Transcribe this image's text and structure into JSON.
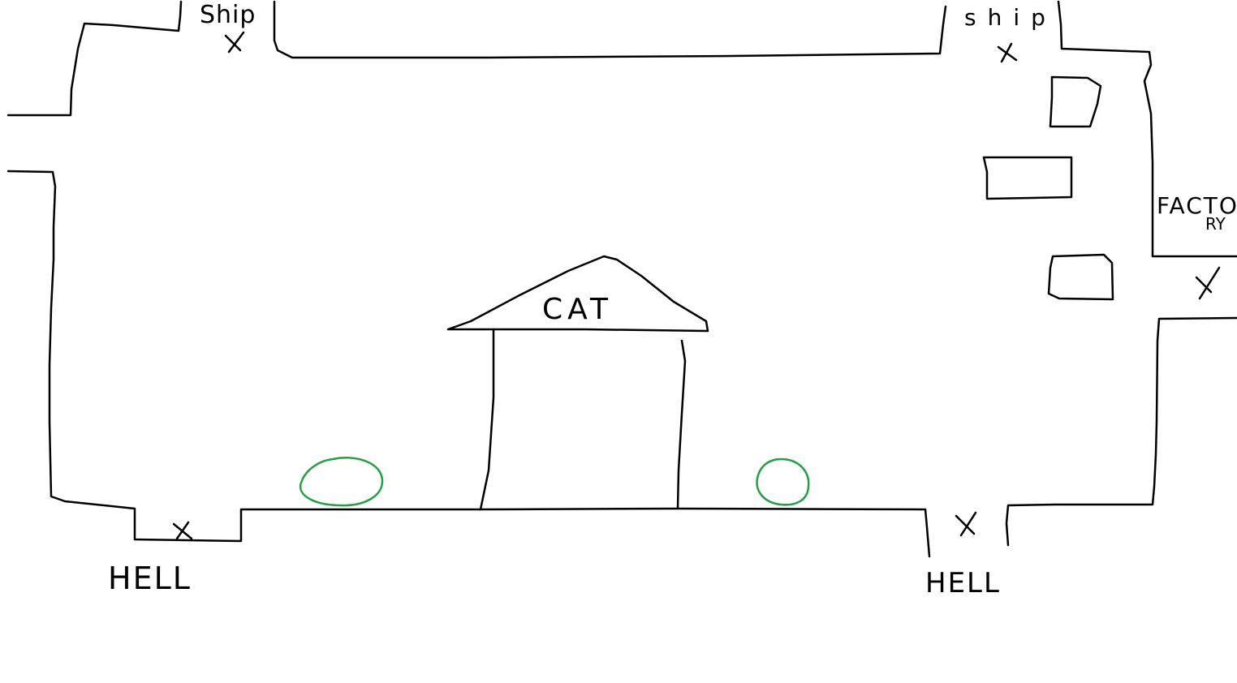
{
  "colors": {
    "background": "#ffffff",
    "ink": "#000000",
    "bush": "#22a045"
  },
  "map": {
    "rooms": [
      {
        "name": "CAT"
      }
    ],
    "labels": {
      "ship_1": "Ship",
      "ship_2": "ship",
      "cat": "CAT",
      "factory_part_1": "FACTO",
      "factory_part_2": "RY",
      "hell_1": "HELL",
      "hell_2": "HELL"
    },
    "markers": [
      {
        "type": "exit",
        "symbol": "X",
        "destination": "Ship"
      },
      {
        "type": "exit",
        "symbol": "X",
        "destination": "ship"
      },
      {
        "type": "exit",
        "symbol": "X",
        "destination": "FACTORY"
      },
      {
        "type": "exit",
        "symbol": "X",
        "destination": "HELL"
      },
      {
        "type": "exit",
        "symbol": "X",
        "destination": "HELL"
      }
    ],
    "icons": [
      "bush-icon",
      "bush-icon",
      "crate-icon",
      "crate-icon",
      "crate-icon"
    ]
  }
}
